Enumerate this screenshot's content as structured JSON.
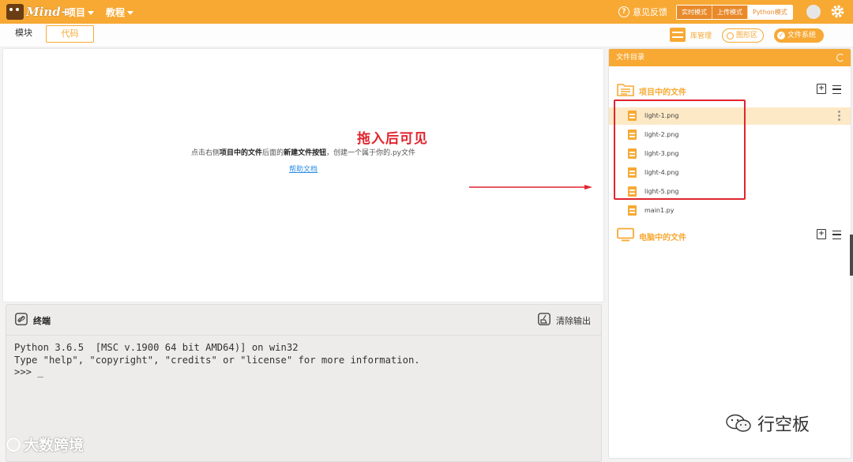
{
  "app": {
    "logo_text": "Mind+",
    "menus": [
      {
        "label": "项目"
      },
      {
        "label": "教程"
      }
    ],
    "feedback_label": "意见反馈",
    "modes": [
      {
        "label": "实时模式",
        "active": false
      },
      {
        "label": "上传模式",
        "active": false
      },
      {
        "label": "Python模式",
        "active": true
      }
    ],
    "accent_color": "#f7a934"
  },
  "tabs": [
    {
      "label": "模块",
      "active": false
    },
    {
      "label": "代码",
      "active": true
    }
  ],
  "toolbar": {
    "library_manager": "库管理",
    "graphics_area": "图形区",
    "file_system": "文件系统"
  },
  "editor": {
    "hint_prefix": "点击右侧",
    "hint_bold1": "项目中的文件",
    "hint_mid": "后面的",
    "hint_bold2": "新建文件按钮",
    "hint_suffix": "，创建一个属于你的.py文件",
    "help_link": "帮助文档"
  },
  "annotation": {
    "text": "拖入后可见",
    "color": "#e0242e"
  },
  "terminal": {
    "title": "终端",
    "clear_label": "清除输出",
    "lines": [
      "Python 3.6.5  [MSC v.1900 64 bit AMD64)] on win32",
      "Type \"help\", \"copyright\", \"credits\" or \"license\" for more information.",
      ">>> _"
    ]
  },
  "file_panel": {
    "title": "文件目录",
    "project_section": "项目中的文件",
    "computer_section": "电脑中的文件",
    "project_files": [
      {
        "name": "light-1.png",
        "selected": true
      },
      {
        "name": "light-2.png",
        "selected": false
      },
      {
        "name": "light-3.png",
        "selected": false
      },
      {
        "name": "light-4.png",
        "selected": false
      },
      {
        "name": "light-5.png",
        "selected": false
      },
      {
        "name": "main1.py",
        "selected": false
      }
    ]
  },
  "watermarks": {
    "left": "大数跨境",
    "right": "行空板"
  }
}
